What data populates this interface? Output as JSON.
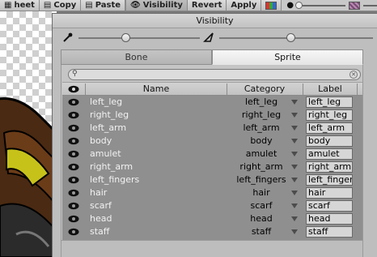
{
  "toolbar": {
    "items": [
      {
        "label": "heet",
        "icon": "sheet-icon"
      },
      {
        "label": "Copy",
        "icon": "copy-icon"
      },
      {
        "label": "Paste",
        "icon": "paste-icon"
      },
      {
        "label": "Visibility",
        "icon": "eye-icon",
        "active": true
      },
      {
        "label": "Revert"
      },
      {
        "label": "Apply"
      }
    ]
  },
  "window": {
    "title": "Visibility",
    "opacity": {
      "bone_icon": "bone-brush-icon",
      "sprite_icon": "sprite-brush-icon",
      "bone_value": 0.5,
      "sprite_value": 0.5
    },
    "tabs": [
      {
        "label": "Bone",
        "selected": false
      },
      {
        "label": "Sprite",
        "selected": true
      }
    ],
    "search": {
      "value": "",
      "placeholder": ""
    },
    "columns": {
      "visible": "eye-icon",
      "name": "Name",
      "category": "Category",
      "label": "Label"
    },
    "rows": [
      {
        "name": "left_leg",
        "category": "left_leg",
        "label": "left_leg"
      },
      {
        "name": "right_leg",
        "category": "right_leg",
        "label": "right_leg"
      },
      {
        "name": "left_arm",
        "category": "left_arm",
        "label": "left_arm"
      },
      {
        "name": "body",
        "category": "body",
        "label": "body"
      },
      {
        "name": "amulet",
        "category": "amulet",
        "label": "amulet"
      },
      {
        "name": "right_arm",
        "category": "right_arm",
        "label": "right_arm"
      },
      {
        "name": "left_fingers",
        "category": "left_fingers",
        "label": "left_fingers"
      },
      {
        "name": "hair",
        "category": "hair",
        "label": "hair"
      },
      {
        "name": "scarf",
        "category": "scarf",
        "label": "scarf"
      },
      {
        "name": "head",
        "category": "head",
        "label": "head"
      },
      {
        "name": "staff",
        "category": "staff",
        "label": "staff"
      }
    ]
  },
  "colors": {
    "row_bg": "#8f8f8f",
    "panel_bg": "#bebebe",
    "accent_swatch": "#8c2a6a"
  }
}
